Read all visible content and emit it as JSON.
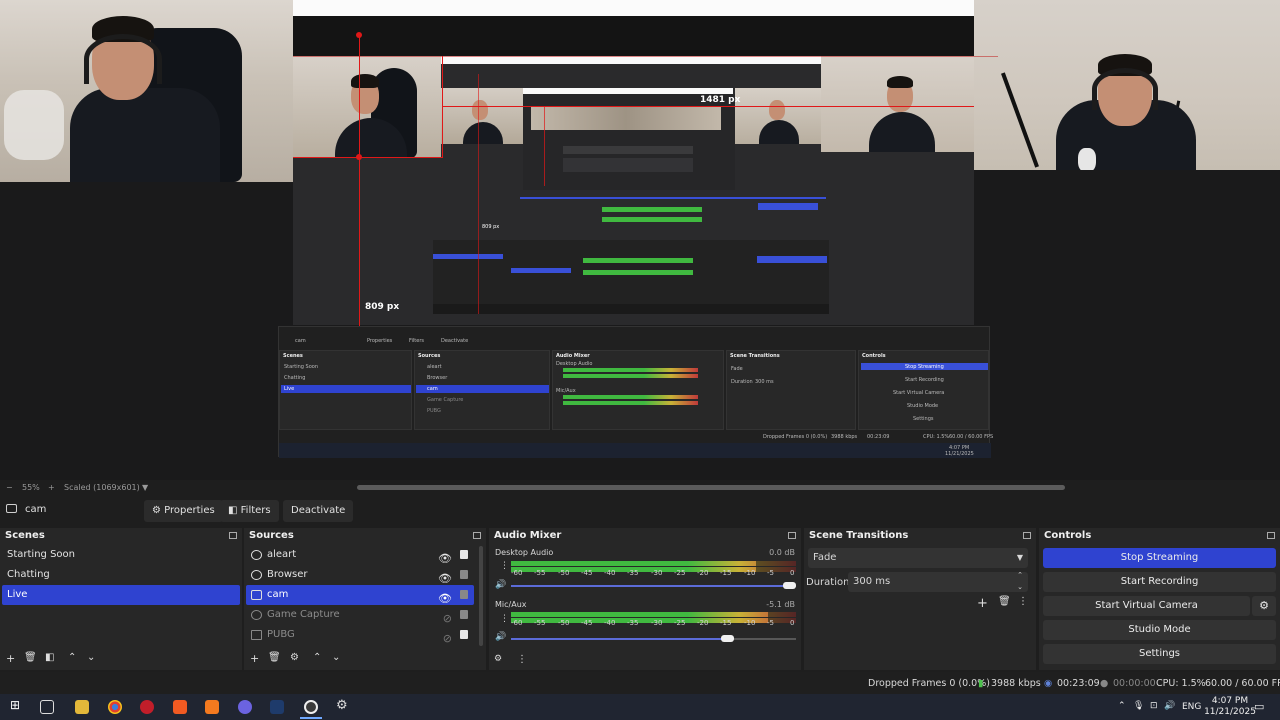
{
  "preview": {
    "label_1481": "1481 px",
    "label_809": "809 px",
    "label_809_small": "809 px",
    "zoom": "55%",
    "scale_mode": "Scaled (1069x601)"
  },
  "source_toolbar": {
    "source_name": "cam",
    "properties": "Properties",
    "filters": "Filters",
    "deactivate": "Deactivate"
  },
  "scenes": {
    "title": "Scenes",
    "items": [
      "Starting Soon",
      "Chatting",
      "Live"
    ],
    "selected": "Live"
  },
  "sources": {
    "title": "Sources",
    "items": [
      "aleart",
      "Browser",
      "cam",
      "Game Capture",
      "PUBG"
    ]
  },
  "audio_mixer": {
    "title": "Audio Mixer",
    "channels": [
      {
        "name": "Desktop Audio",
        "db": "0.0 dB",
        "level": 0.86,
        "volume": 0.98
      },
      {
        "name": "Mic/Aux",
        "db": "-5.1 dB",
        "level": 0.9,
        "volume": 0.76
      }
    ],
    "ticks": [
      "-60",
      "-55",
      "-50",
      "-45",
      "-40",
      "-35",
      "-30",
      "-25",
      "-20",
      "-15",
      "-10",
      "-5",
      "0"
    ]
  },
  "scene_transitions": {
    "title": "Scene Transitions",
    "transition": "Fade",
    "duration_label": "Duration",
    "duration_value": "300 ms"
  },
  "controls": {
    "title": "Controls",
    "stop_streaming": "Stop Streaming",
    "start_recording": "Start Recording",
    "start_virtual_camera": "Start Virtual Camera",
    "studio_mode": "Studio Mode",
    "settings": "Settings"
  },
  "status": {
    "dropped_frames": "Dropped Frames 0 (0.0%)",
    "bitrate": "3988 kbps",
    "stream_time": "00:23:09",
    "rec_time": "00:00:00",
    "cpu": "CPU: 1.5%",
    "fps": "60.00 / 60.00 FPS"
  },
  "taskbar": {
    "lang": "ENG",
    "time": "4:07 PM",
    "date": "11/21/2025"
  },
  "colors": {
    "accent": "#2f43d0",
    "guide_red": "#e01818",
    "meter_green": "#40b940",
    "meter_yellow": "#c8b237",
    "meter_red": "#c03a3a"
  },
  "mini": {
    "scenes": "Scenes",
    "sources": "Sources",
    "audio_mixer": "Audio Mixer",
    "scene_transitions": "Scene Transitions",
    "controls": "Controls",
    "stop_streaming": "Stop Streaming",
    "start_recording": "Start Recording",
    "start_virtual_camera": "Start Virtual Camera",
    "studio_mode": "Studio Mode",
    "settings": "Settings",
    "properties": "Properties",
    "filters": "Filters",
    "deactivate": "Deactivate",
    "cam": "cam",
    "starting_soon": "Starting Soon",
    "chatting": "Chatting",
    "live": "Live",
    "aleart": "aleart",
    "browser": "Browser",
    "game_capture": "Game Capture",
    "pubg": "PUBG",
    "desktop_audio": "Desktop Audio",
    "mic_aux": "Mic/Aux",
    "fade": "Fade",
    "duration": "Duration",
    "duration_value": "300 ms",
    "dropped": "Dropped Frames 0 (0.0%)",
    "bitrate": "3988 kbps",
    "stream_time": "00:23:09",
    "cpu": "CPU: 1.5%",
    "fps": "60.00 / 60.00 FPS",
    "scaled": "Scaled (1069x601)",
    "zoom": "55%",
    "clock": "4:07 PM",
    "date": "11/21/2025"
  }
}
